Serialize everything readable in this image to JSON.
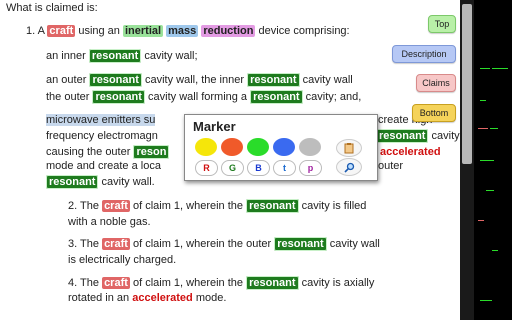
{
  "heading": "What is claimed is:",
  "claim1": {
    "num": "1. A",
    "craft": "craft",
    "t_using_an": "using an",
    "inertial": "inertial",
    "mass": "mass",
    "reduction": "reduction",
    "t_device": "device comprising:",
    "l2a": "an inner",
    "l2b": "resonant",
    "l2c": "cavity wall;",
    "l3a": "an outer",
    "l3b": "resonant",
    "l3c": "cavity wall, the inner",
    "l3d": "resonant",
    "l3e": "cavity wall",
    "l4a": "the outer",
    "l4b": "resonant",
    "l4c": "cavity wall forming a",
    "l4d": "resonant",
    "l4e": "cavity; and,",
    "l5a": "microwave emitters su",
    "l5b": "create high",
    "l6a": "frequency electromagn",
    "l6b": "resonant",
    "l6c": "cavity",
    "l7a": "causing the outer",
    "l7b": "reson",
    "l7c": "accelerated",
    "l8a": "mode and create a loca",
    "l8b": "outer",
    "l9a": "resonant",
    "l9b": "cavity wall."
  },
  "claim2": {
    "a": "2. The",
    "b": "craft",
    "c": "of claim 1, wherein the",
    "d": "resonant",
    "e": "cavity is filled",
    "f": "with a noble gas."
  },
  "claim3": {
    "a": "3. The",
    "b": "craft",
    "c": "of claim 1, wherein the outer",
    "d": "resonant",
    "e": "cavity wall",
    "f": "is electrically charged."
  },
  "claim4": {
    "a": "4. The",
    "b": "craft",
    "c": "of claim 1, wherein the",
    "d": "resonant",
    "e": "cavity is axially",
    "f": "rotated in an",
    "g": "accelerated",
    "h": "mode."
  },
  "nav": {
    "top": "Top",
    "description": "Description",
    "claims": "Claims",
    "bottom": "Bottom"
  },
  "marker": {
    "title": "Marker",
    "colors": [
      "#f5e60a",
      "#f05a2a",
      "#2adc2a",
      "#3a6af0",
      "#bdbdbd"
    ],
    "pills": [
      "R",
      "G",
      "B",
      "t",
      "p"
    ],
    "pill_colors": [
      "#d01010",
      "#1e7b1e",
      "#1a3ad0",
      "#1a6ad0",
      "#a020a0"
    ],
    "tool_icons": [
      "clipboard-icon",
      "search-icon"
    ]
  }
}
